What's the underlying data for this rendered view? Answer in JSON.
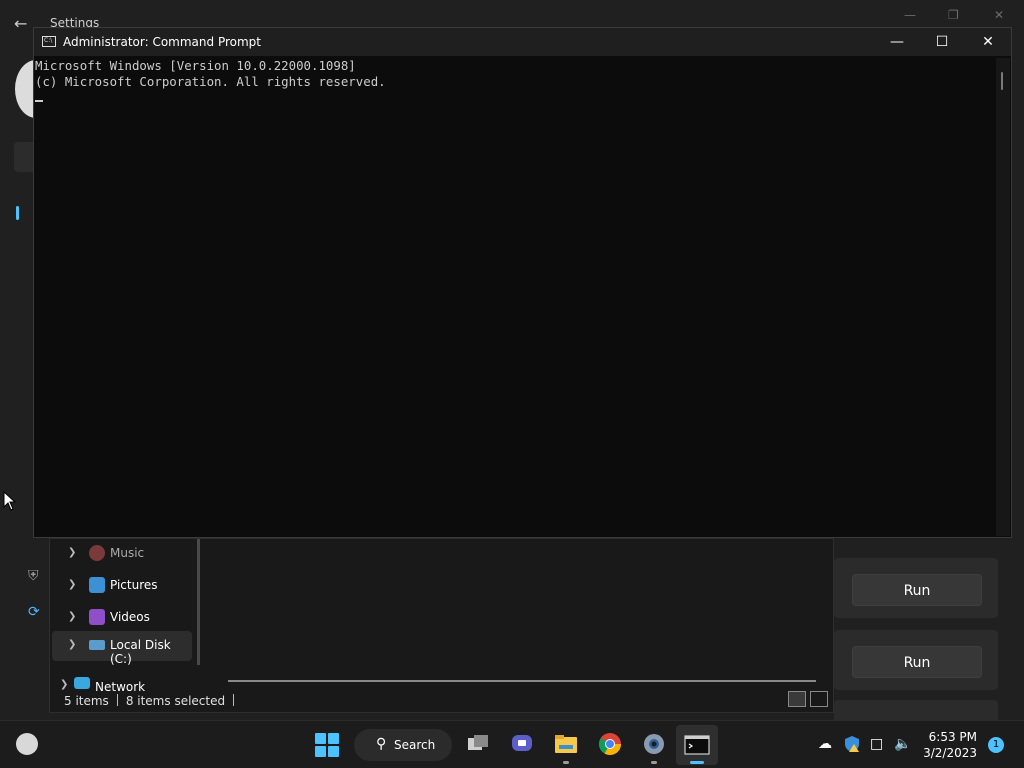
{
  "settings": {
    "title": "Settings",
    "run_buttons": [
      "Run",
      "Run"
    ]
  },
  "explorer": {
    "tree": [
      {
        "label": "Music",
        "icon": "music-folder-icon",
        "color": "#c05050"
      },
      {
        "label": "Pictures",
        "icon": "pictures-folder-icon",
        "color": "#4aa3e8"
      },
      {
        "label": "Videos",
        "icon": "videos-folder-icon",
        "color": "#9b59d0"
      },
      {
        "label": "Local Disk (C:)",
        "icon": "drive-icon",
        "color": "#6fb7e8"
      },
      {
        "label": "Network",
        "icon": "network-icon",
        "color": "#4cb8e8"
      }
    ],
    "status": {
      "items": "5 items",
      "selected": "8 items selected"
    }
  },
  "cmd": {
    "title": "Administrator: Command Prompt",
    "lines": [
      "Microsoft Windows [Version 10.0.22000.1098]",
      "(c) Microsoft Corporation. All rights reserved."
    ]
  },
  "taskbar": {
    "search_label": "Search",
    "time": "6:53 PM",
    "date": "3/2/2023",
    "notification_count": "1"
  },
  "colors": {
    "accent": "#4cc2ff",
    "console_bg": "#0c0c0c",
    "console_text": "#cccccc"
  }
}
